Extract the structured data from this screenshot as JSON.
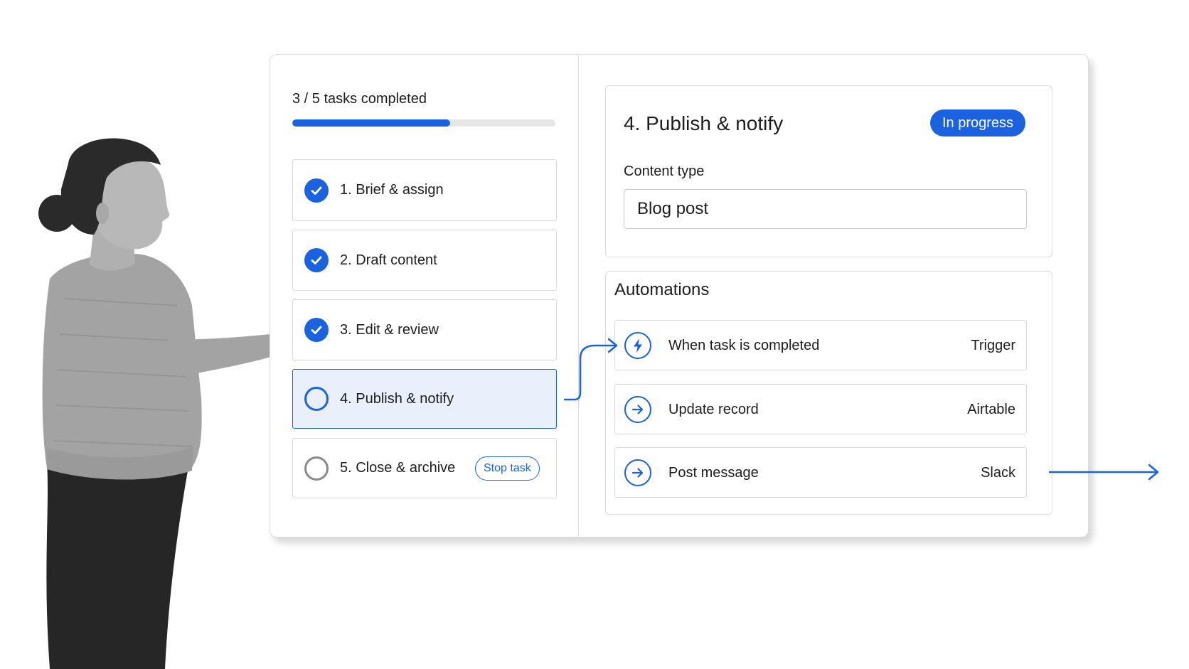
{
  "progress": {
    "label": "3 / 5 tasks completed",
    "completed": 3,
    "total": 5
  },
  "tasks": [
    {
      "label": "1. Brief & assign",
      "status": "done"
    },
    {
      "label": "2. Draft content",
      "status": "done"
    },
    {
      "label": "3. Edit & review",
      "status": "done"
    },
    {
      "label": "4. Publish & notify",
      "status": "active"
    },
    {
      "label": "5. Close & archive",
      "status": "pending",
      "action_label": "Stop task"
    }
  ],
  "detail": {
    "title": "4. Publish & notify",
    "status_label": "In progress",
    "field_label": "Content type",
    "field_value": "Blog post"
  },
  "automations": {
    "title": "Automations",
    "items": [
      {
        "label": "When task is completed",
        "service": "Trigger",
        "icon": "lightning-bolt-icon"
      },
      {
        "label": "Update record",
        "service": "Airtable",
        "icon": "arrow-right-icon"
      },
      {
        "label": "Post message",
        "service": "Slack",
        "icon": "arrow-right-icon"
      }
    ]
  },
  "colors": {
    "accent": "#1a62e0",
    "active_row_bg": "#e9effb",
    "border": "#d9d9d9"
  }
}
